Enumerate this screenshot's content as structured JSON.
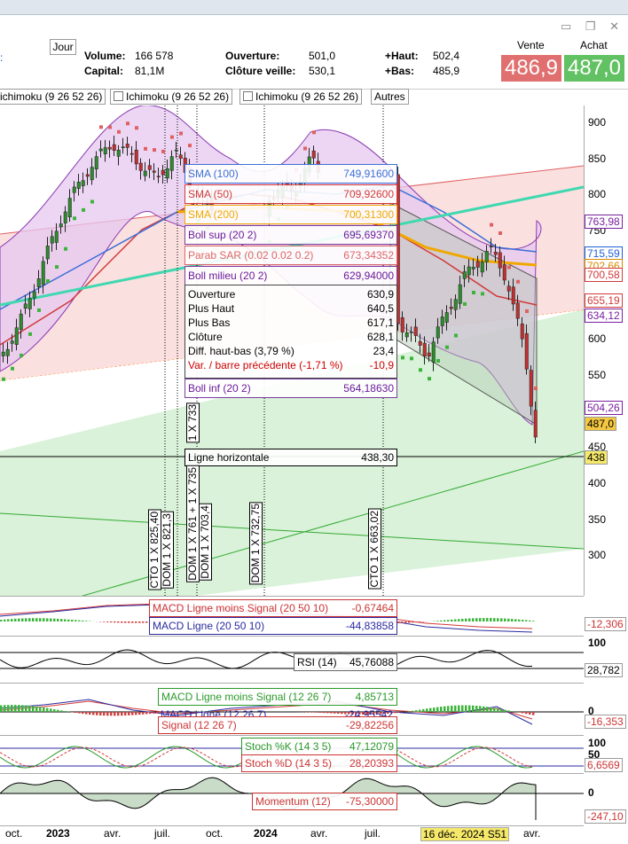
{
  "window": {
    "controls": "▭ ❐ ✕"
  },
  "header": {
    "period": "Jour",
    "volume_label": "Volume:",
    "volume": "166 578",
    "capital_label": "Capital:",
    "capital": "81,1M",
    "ouverture_label": "Ouverture:",
    "ouverture": "501,0",
    "cloture_label": "Clôture veille:",
    "cloture": "530,1",
    "haut_label": "+Haut:",
    "haut": "502,4",
    "bas_label": "+Bas:",
    "bas": "485,9",
    "vente_label": "Vente",
    "vente": "486,9",
    "achat_label": "Achat",
    "achat": "487,0"
  },
  "tabs": [
    "ichimoku (9 26 52 26)",
    "Ichimoku (9 26 52 26)",
    "Ichimoku (9 26 52 26)",
    "Autres"
  ],
  "legends": [
    {
      "name": "SMA (100)",
      "value": "749,91600",
      "color": "#3b6fd6"
    },
    {
      "name": "SMA (50)",
      "value": "709,92600",
      "color": "#d23a3a"
    },
    {
      "name": "SMA (200)",
      "value": "700,31300",
      "color": "#f0a800"
    },
    {
      "name": "Boll sup (20 2)",
      "value": "695,69370",
      "color": "#6a1a9a"
    },
    {
      "name": "Parab SAR (0.02 0.02 0.2)",
      "value": "673,34352",
      "color": "#d66"
    },
    {
      "name": "Boll milieu (20 2)",
      "value": "629,94000",
      "color": "#6a1a9a"
    }
  ],
  "ohlc": [
    {
      "name": "Ouverture",
      "value": "630,9"
    },
    {
      "name": "Plus Haut",
      "value": "640,5"
    },
    {
      "name": "Plus Bas",
      "value": "617,1"
    },
    {
      "name": "Clôture",
      "value": "628,1"
    },
    {
      "name": "Diff. haut-bas (3,79 %)",
      "value": "23,4"
    },
    {
      "name": "Var. / barre précédente (-1,71 %)",
      "value": "-10,9"
    }
  ],
  "boll_inf": {
    "name": "Boll inf (20 2)",
    "value": "564,18630"
  },
  "hline": {
    "name": "Ligne horizontale",
    "value": "438,30",
    "tag": "438"
  },
  "price_axis": [
    "900",
    "850",
    "800",
    "750",
    "700",
    "650",
    "600",
    "550",
    "500",
    "450",
    "400",
    "350",
    "300"
  ],
  "right_tags": [
    {
      "text": "763,98",
      "color": "#7a1fa0"
    },
    {
      "text": "715,59",
      "color": "#1f5fd6"
    },
    {
      "text": "702,66",
      "color": "#d68a00"
    },
    {
      "text": "700,58",
      "color": "#d23a3a"
    },
    {
      "text": "655,19",
      "color": "#d23a3a"
    },
    {
      "text": "634,12",
      "color": "#7a1fa0"
    },
    {
      "text": "504,26",
      "color": "#7a1fa0"
    },
    {
      "text": "487,0",
      "color": "#000"
    },
    {
      "text": "438",
      "color": "#000"
    }
  ],
  "annotations": [
    "CTO 1 X 825,40",
    "DOM 1 X 821,3",
    "DOM 1 X 761 + 1 X 735",
    "1 X 733",
    "DOM 1 X 703,4",
    "DOM 1 X 732,75",
    "CTO 1 X 663,02"
  ],
  "macd1": {
    "line1_name": "MACD Ligne moins Signal (20 50 10)",
    "line1_value": "-0,67464",
    "line2_name": "MACD Ligne (20 50 10)",
    "line2_value": "-44,83858",
    "tag": "-12,306"
  },
  "rsi": {
    "name": "RSI (14)",
    "value": "45,76088",
    "axis_top": "100",
    "tag": "28,782"
  },
  "macd2": {
    "line1_name": "MACD Ligne moins Signal (12 26 7)",
    "line1_value": "4,85713",
    "line2_name": "MACD Ligne (12 26 7)",
    "line2_value": "-24,95542",
    "line3_name": "Signal (12 26 7)",
    "line3_value": "-29,82256",
    "axis_zero": "0",
    "tag": "-16,353"
  },
  "stoch": {
    "k_name": "Stoch %K (14 3 5)",
    "k_value": "47,12079",
    "d_name": "Stoch %D (14 3 5)",
    "d_value": "28,20393",
    "axis_top": "100",
    "axis_mid": "50",
    "tag": "6,6569"
  },
  "momentum": {
    "name": "Momentum (12)",
    "value": "-75,30000",
    "axis_zero": "0",
    "tag": "-247,10"
  },
  "x_axis": [
    "oct.",
    "2023",
    "avr.",
    "juil.",
    "oct.",
    "2024",
    "avr.",
    "juil.",
    "avr."
  ],
  "cursor_date": "16 déc. 2024 S51",
  "chart_data": {
    "type": "candlestick",
    "title": "",
    "x_range": [
      "2022-09",
      "2025-04"
    ],
    "ylim": [
      280,
      930
    ],
    "x": [
      "2022-10",
      "2022-11",
      "2022-12",
      "2023-01",
      "2023-02",
      "2023-03",
      "2023-04",
      "2023-05",
      "2023-06",
      "2023-07",
      "2023-08",
      "2024-03",
      "2024-04",
      "2024-10",
      "2024-11",
      "2024-12",
      "2025-01",
      "2025-02",
      "2025-03",
      "2025-04"
    ],
    "close": [
      600,
      640,
      700,
      790,
      850,
      880,
      860,
      830,
      870,
      820,
      790,
      820,
      860,
      640,
      600,
      700,
      740,
      700,
      600,
      487
    ]
  }
}
